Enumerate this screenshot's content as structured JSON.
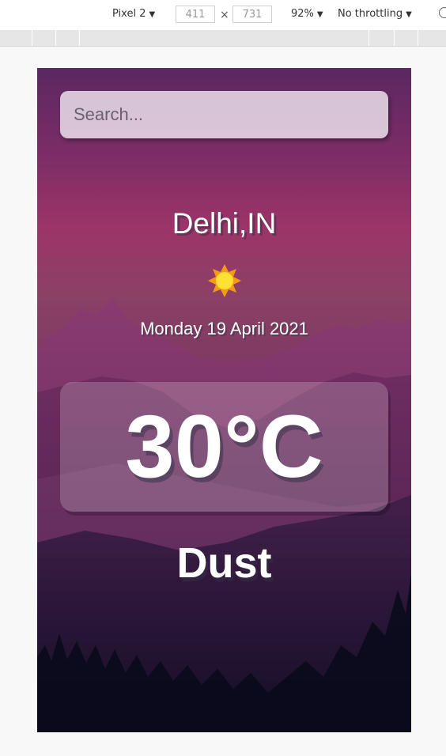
{
  "devtools": {
    "device": "Pixel 2",
    "width": "411",
    "height": "731",
    "times": "×",
    "zoom": "92%",
    "throttling": "No throttling",
    "dropdown_glyph": "▼"
  },
  "app": {
    "search_placeholder": "Search...",
    "location": "Delhi,IN",
    "date": "Monday 19 April 2021",
    "temperature": "30°C",
    "condition": "Dust",
    "condition_icon": "sun-icon"
  },
  "colors": {
    "sun_core": "#ffe033",
    "sun_rays": "#f59a16",
    "bg_top": "#5a2862",
    "bg_mid": "#9c3468",
    "bg_bottom": "#0b0a1e"
  }
}
